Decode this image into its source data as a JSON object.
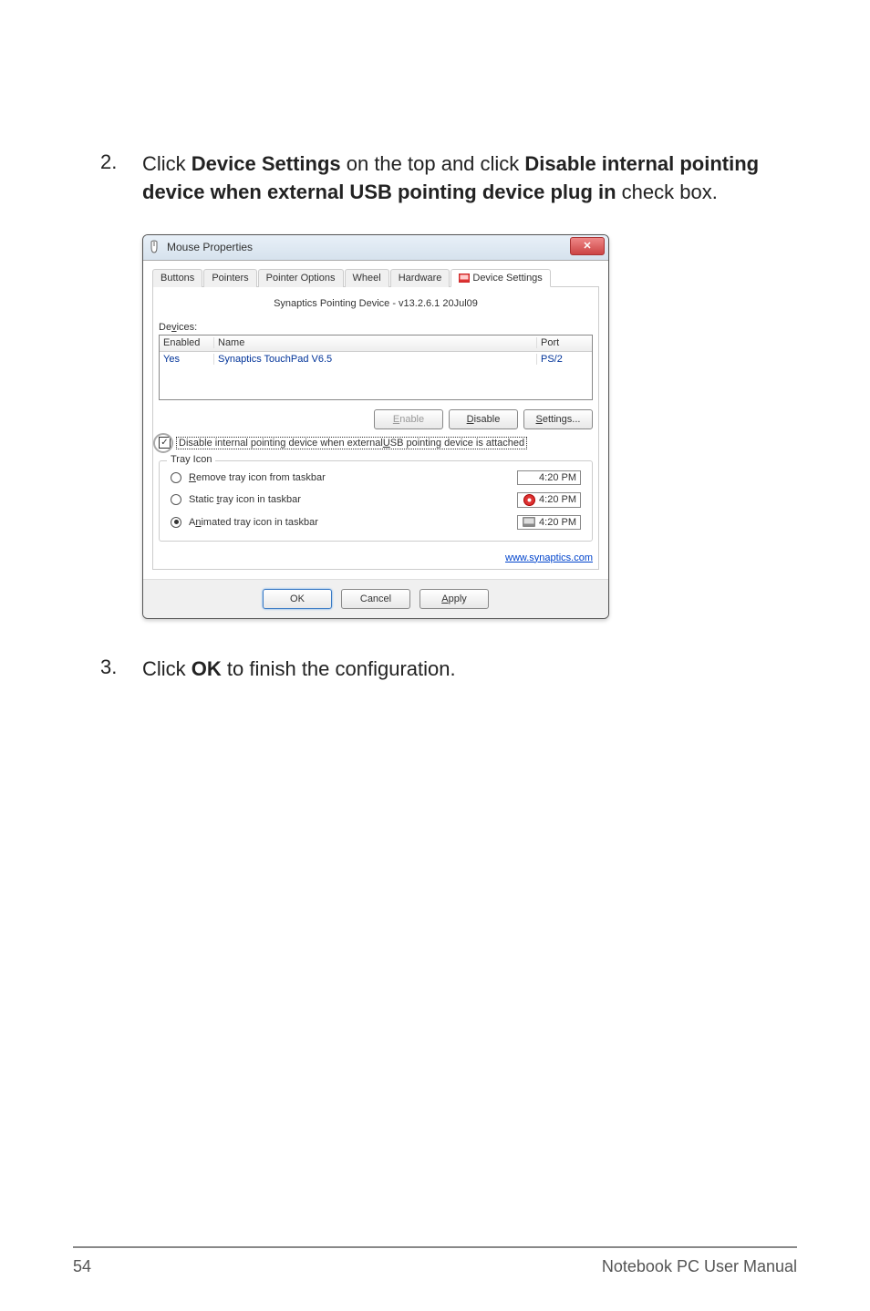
{
  "step2": {
    "num": "2.",
    "text_prefix": "Click ",
    "bold1": "Device Settings",
    "text_mid": " on the top and click ",
    "bold2": "Disable internal pointing device when external USB pointing device plug in",
    "text_suffix": " check box."
  },
  "dialog": {
    "title": "Mouse Properties",
    "close": "✕",
    "tabs": {
      "buttons": "Buttons",
      "pointers": "Pointers",
      "pointer_options": "Pointer Options",
      "wheel": "Wheel",
      "hardware": "Hardware",
      "device_settings": "Device Settings"
    },
    "driver_line": "Synaptics Pointing Device - v13.2.6.1 20Jul09",
    "devices_label_pre": "De",
    "devices_label_u": "v",
    "devices_label_post": "ices:",
    "table": {
      "h_enabled": "Enabled",
      "h_name": "Name",
      "h_port": "Port",
      "r_enabled": "Yes",
      "r_name": "Synaptics TouchPad V6.5",
      "r_port": "PS/2"
    },
    "btn_enable_pre": "",
    "btn_enable_u": "E",
    "btn_enable_post": "nable",
    "btn_disable_pre": "",
    "btn_disable_u": "D",
    "btn_disable_post": "isable",
    "btn_settings_pre": "",
    "btn_settings_u": "S",
    "btn_settings_post": "ettings...",
    "chk_label_pre": "Disable internal pointing device when external ",
    "chk_label_u": "U",
    "chk_label_post": "SB pointing device is attached",
    "tray_legend": "Tray Icon",
    "radio1_u": "R",
    "radio1_post": "emove tray icon from taskbar",
    "radio2_pre": "Static ",
    "radio2_u": "t",
    "radio2_post": "ray icon in taskbar",
    "radio3_pre": "A",
    "radio3_u": "n",
    "radio3_post": "imated tray icon in taskbar",
    "time1": "4:20 PM",
    "time2": "4:20 PM",
    "time3": "4:20 PM",
    "link": "www.synaptics.com",
    "btn_ok": "OK",
    "btn_cancel": "Cancel",
    "btn_apply_u": "A",
    "btn_apply_post": "pply"
  },
  "step3": {
    "num": "3.",
    "text_prefix": "Click ",
    "bold": "OK",
    "text_suffix": " to finish the configuration."
  },
  "footer": {
    "page": "54",
    "manual": "Notebook PC User Manual"
  }
}
